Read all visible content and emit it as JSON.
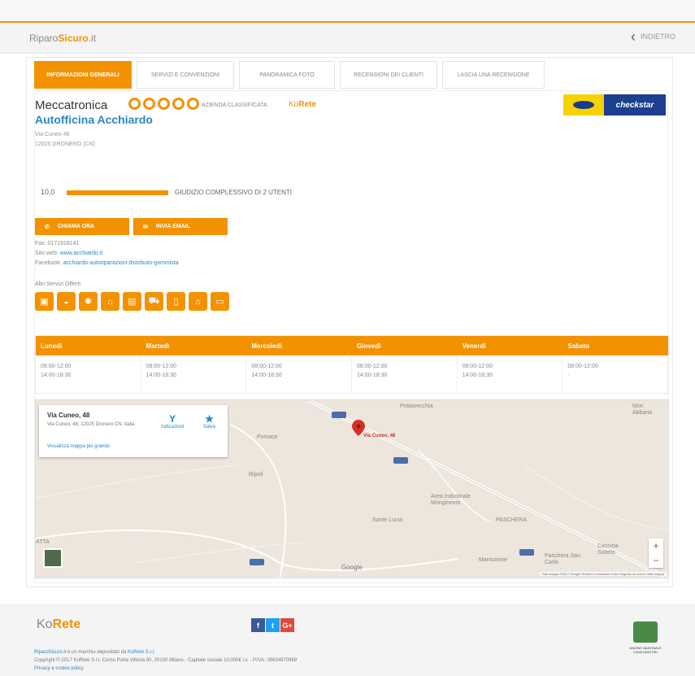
{
  "header": {
    "logo_a": "Riparo",
    "logo_b": "Sicuro",
    "logo_c": ".it",
    "back_label": "INDIETRO"
  },
  "tabs": [
    {
      "label": "Informazioni generali"
    },
    {
      "label": "Servizi e convenzioni"
    },
    {
      "label": "Panoramica foto"
    },
    {
      "label": "Recensioni dei clienti"
    },
    {
      "label": "Lascia una recensione"
    }
  ],
  "business": {
    "category": "Meccatronica",
    "classified_label": "Azienda classificata",
    "classified_brand_a": "Ko",
    "classified_brand_b": "Rete",
    "badge_label": "checkstar",
    "name": "Autofficina Acchiardo",
    "address_line1": "Via Cuneo 48",
    "address_line2": "12025 DRONERO (CN)"
  },
  "rating": {
    "score": "10,0",
    "fraction": 1.0,
    "label": "Giudizio complessivo di 2 utenti"
  },
  "actions": {
    "call_label": "Chiama ora",
    "email_label": "Invia email"
  },
  "contacts": {
    "fax": "Fax: 0171918141",
    "site_prefix": "Sito web:",
    "site": "www.acchiardo.it",
    "facebook_prefix": "Facebook:",
    "facebook": "acchiardo-autoriparazioni-distributo-gommista"
  },
  "services": {
    "label": "Altri Servizi Offerti",
    "icons": [
      "calendar-icon",
      "car-wash-icon",
      "tire-icon",
      "home-icon",
      "printer-icon",
      "tow-truck-icon",
      "phone-icon",
      "car-icon",
      "display-icon"
    ],
    "glyphs": [
      "▣",
      "◒",
      "✺",
      "⌂",
      "▤",
      "⛟",
      "▯",
      "⌂",
      "▭"
    ]
  },
  "hours": {
    "days": [
      "Lunedì",
      "Martedì",
      "Mercoledì",
      "Giovedì",
      "Venerdì",
      "Sabato"
    ],
    "values": [
      "08:00-12:00\n14:00-18:30",
      "08:00-12:00\n14:00-18:30",
      "08:00-12:00\n14:00-18:30",
      "08:00-12:00\n14:00-18:30",
      "08:00-12:00\n14:00-18:30",
      "08:00-12:00\n-"
    ]
  },
  "map": {
    "card_title": "Via Cuneo, 48",
    "card_subtitle": "Via Cuneo, 48, 12025 Dronero CN, Italia",
    "card_link": "Visualizza mappa più grande",
    "directions": "Indicazioni",
    "save": "Salva",
    "pin_label": "Via Cuneo, 48",
    "places": [
      "Pratavecchia",
      "Pomace",
      "Ripoli",
      "Area Industriale Monginevro",
      "Sante Lucia",
      "PASCHERA",
      "Mantuonne",
      "Paschera San Carlo",
      "Cascina Soletta",
      "ATTA",
      "Mon Abbaria"
    ],
    "google": "Google",
    "copyright": "Dati mappa ©2017 Google   Termini e condizioni d'uso   Segnala un errore nella mappa"
  },
  "footer": {
    "brand_a": "Ko",
    "brand_b": "Rete",
    "line1_site": "RiparoSicuro.it",
    "line1_rest": "è un marchio depositato da",
    "line1_owner": "KoRete S.r.l.",
    "line2": "Copyright © 2017 KoRete S.r.l. Corso Porta Vittoria 50, 20100 Milano - Capitale sociale 10.000€ i.v. - P.IVA: 08634970969",
    "line3": "Privacy e cookie policy",
    "consumer_label": "Unione Nazionale Consumatori"
  },
  "colors": {
    "accent": "#f39200",
    "link": "#2a86c6",
    "facebook": "#3b5998",
    "twitter": "#1da1f2",
    "gplus": "#dd4b39"
  }
}
